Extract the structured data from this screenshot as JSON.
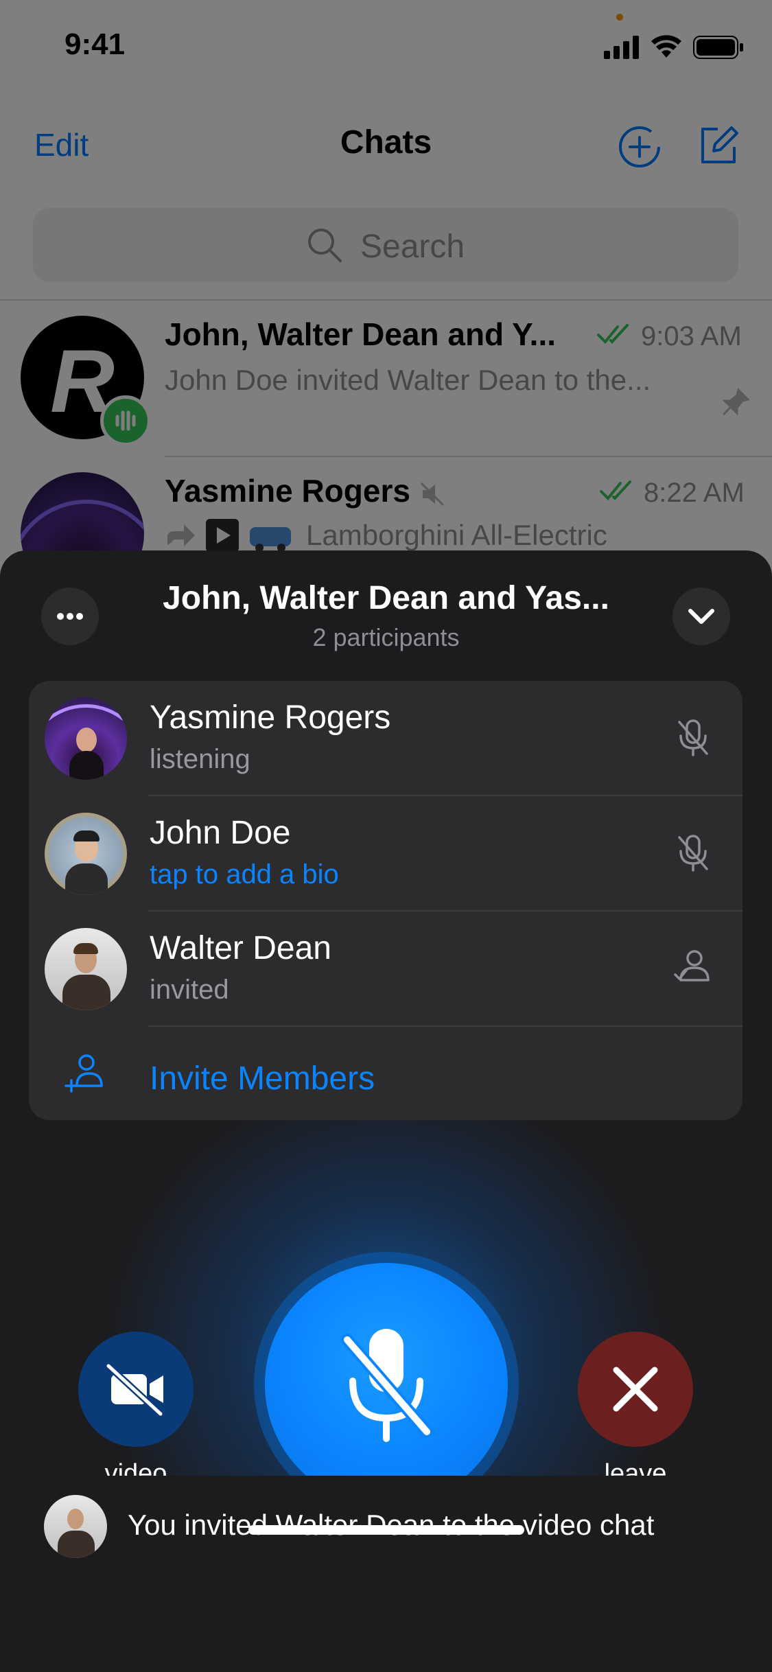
{
  "status_bar": {
    "time": "9:41"
  },
  "nav": {
    "edit_label": "Edit",
    "title": "Chats"
  },
  "search": {
    "placeholder": "Search"
  },
  "chat_list": [
    {
      "name": "John, Walter Dean and Y...",
      "time": "9:03 AM",
      "preview": "John Doe invited Walter Dean to the...",
      "avatar_letter": "R"
    },
    {
      "name": "Yasmine Rogers",
      "time": "8:22 AM",
      "preview": "Lamborghini All-Electric"
    }
  ],
  "call": {
    "title": "John, Walter Dean and Yas...",
    "subtitle": "2 participants",
    "participants": [
      {
        "name": "Yasmine Rogers",
        "status": "listening",
        "icon": "mic-muted-icon"
      },
      {
        "name": "John Doe",
        "status": "tap to add a bio",
        "icon": "mic-muted-icon"
      },
      {
        "name": "Walter Dean",
        "status": "invited",
        "icon": "invited-person-icon"
      }
    ],
    "invite_label": "Invite Members",
    "controls": {
      "video_label": "video",
      "leave_label": "leave"
    },
    "toast": "You invited Walter Dean to the video chat"
  },
  "colors": {
    "accent": "#0a84ff",
    "leave": "#6b1f1f",
    "online": "#34c759"
  }
}
